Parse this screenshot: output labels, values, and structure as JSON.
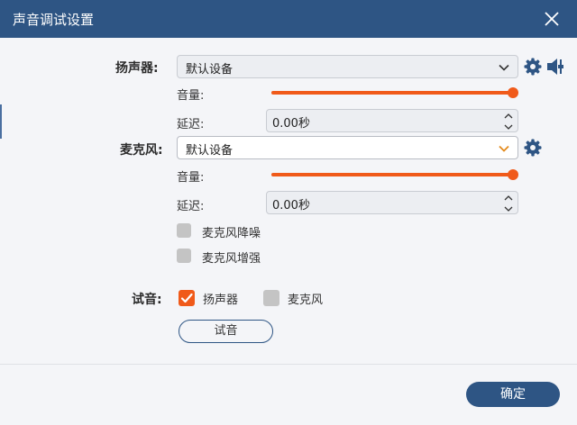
{
  "window": {
    "title": "声音调试设置"
  },
  "speaker": {
    "label": "扬声器:",
    "device": "默认设备",
    "volume_label": "音量:",
    "volume_level": 1.0,
    "delay_label": "延迟:",
    "delay_value": "0.00秒"
  },
  "mic": {
    "label": "麦克风:",
    "device": "默认设备",
    "volume_label": "音量:",
    "volume_level": 1.0,
    "delay_label": "延迟:",
    "delay_value": "0.00秒",
    "noise_reduction_label": "麦克风降噪",
    "noise_reduction_checked": false,
    "enhance_label": "麦克风增强",
    "enhance_checked": false
  },
  "test": {
    "label": "试音:",
    "speaker_label": "扬声器",
    "speaker_checked": true,
    "mic_label": "麦克风",
    "mic_checked": false,
    "button_label": "试音"
  },
  "footer": {
    "ok_label": "确定"
  },
  "colors": {
    "titlebar": "#2e5584",
    "accent": "#f05a1a",
    "checkbox_off": "#c4c4c4"
  },
  "icons": [
    "close-icon",
    "chevron-down-icon",
    "gear-icon",
    "speaker-volume-icon",
    "spin-arrows-icon",
    "checkmark-icon"
  ]
}
